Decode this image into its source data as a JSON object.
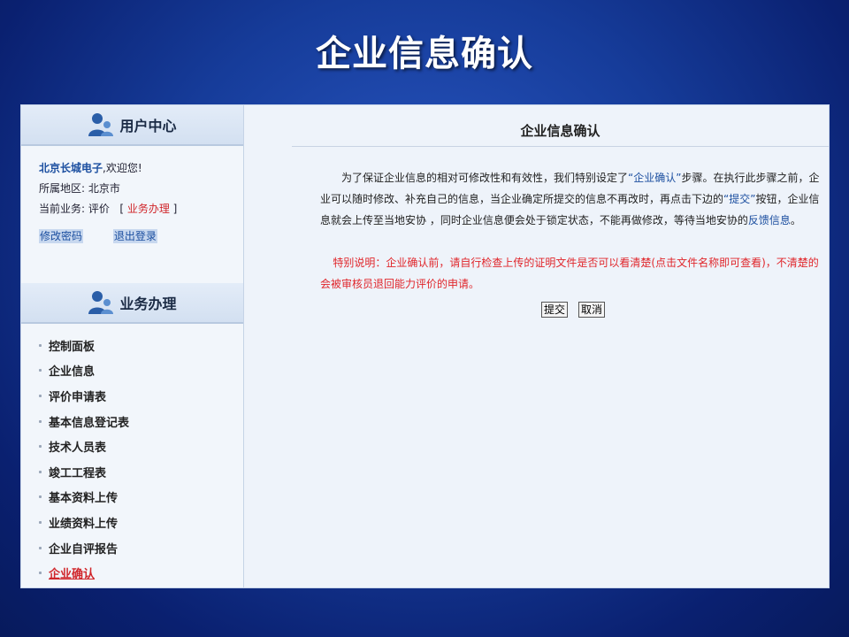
{
  "slide_title": "企业信息确认",
  "sidebar": {
    "user_center_title": "用户中心",
    "company": "北京长城电子",
    "welcome": ",欢迎您!",
    "region_label": "所属地区: ",
    "region_value": "北京市",
    "business_label": "当前业务: ",
    "business_value": "评价",
    "business_link": "业务办理",
    "change_password": "修改密码",
    "logout": "退出登录",
    "business_title": "业务办理",
    "menu": [
      "控制面板",
      "企业信息",
      "评价申请表",
      "基本信息登记表",
      "技术人员表",
      "竣工工程表",
      "基本资料上传",
      "业绩资料上传",
      "企业自评报告",
      "企业确认"
    ]
  },
  "main": {
    "title": "企业信息确认",
    "p1_a": "为了保证企业信息的相对可修改性和有效性，我们特别设定了",
    "p1_q1": "“企业确认”",
    "p1_b": "步骤。在执行此步骤之前，企业可以随时修改、补充自己的信息，当企业确定所提交的信息不再改时，再点击下边的",
    "p1_q2": "“提交”",
    "p1_c": "按钮，企业信息就会上传至当地安协 ，同时企业信息便会处于锁定状态，不能再做修改，等待当地安协的",
    "p1_link": "反馈信息",
    "p1_end": "。",
    "p2": "特别说明：企业确认前，请自行检查上传的证明文件是否可以看清楚(点击文件名称即可查看)，不清楚的会被审核员退回能力评价的申请。",
    "submit": "提交",
    "cancel": "取消"
  }
}
